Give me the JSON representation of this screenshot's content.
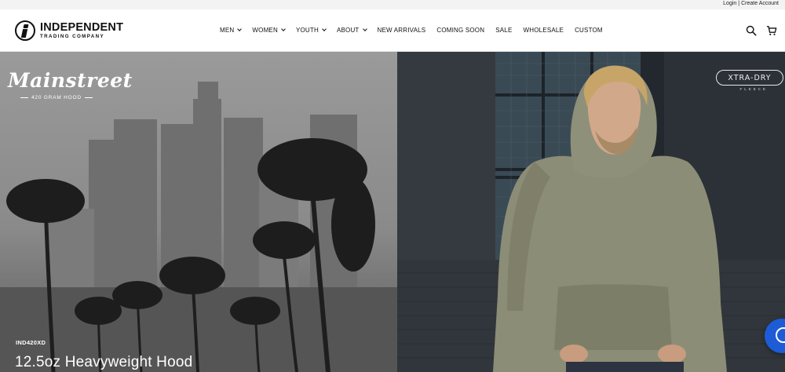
{
  "utility": {
    "login": "Login",
    "separator": "|",
    "create_account": "Create Account"
  },
  "logo": {
    "line1": "INDEPENDENT",
    "line2": "TRADING COMPANY"
  },
  "nav": {
    "items": [
      {
        "label": "MEN",
        "dropdown": true
      },
      {
        "label": "WOMEN",
        "dropdown": true
      },
      {
        "label": "YOUTH",
        "dropdown": true
      },
      {
        "label": "ABOUT",
        "dropdown": true
      },
      {
        "label": "NEW ARRIVALS",
        "dropdown": false
      },
      {
        "label": "COMING SOON",
        "dropdown": false
      },
      {
        "label": "SALE",
        "dropdown": false
      },
      {
        "label": "WHOLESALE",
        "dropdown": false
      },
      {
        "label": "CUSTOM",
        "dropdown": false
      }
    ]
  },
  "header_icons": [
    "search-icon",
    "cart-icon"
  ],
  "hero": {
    "left": {
      "brand": "Mainstreet",
      "brand_sub": "420 GRAM HOOD",
      "sku": "IND420XD",
      "title": "12.5oz Heavyweight Hood"
    },
    "right": {
      "badge": "XTRA-DRY",
      "badge_sub": "FLEECE"
    }
  },
  "colors": {
    "chat_button": "#1e5bd6",
    "hoodie": "#8c8d76",
    "utility_bar": "#f3f3f3"
  }
}
